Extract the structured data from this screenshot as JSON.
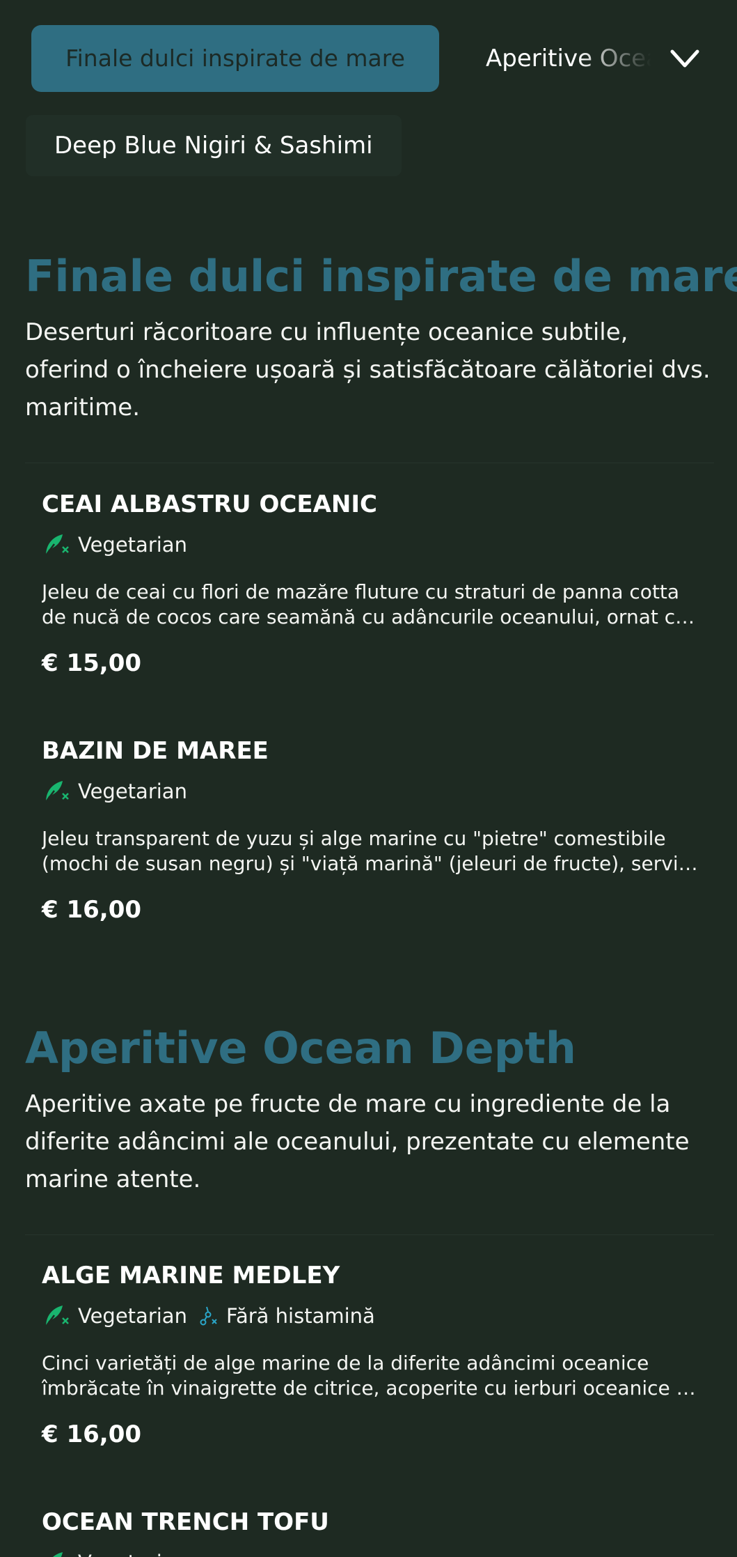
{
  "nav": {
    "active_tab": "Finale dulci inspirate de mare",
    "next_tab": "Aperitive Ocean Depth",
    "second_row_tab": "Deep Blue Nigiri & Sashimi",
    "expand_icon": "chevron-down-icon"
  },
  "colors": {
    "background": "#1e2a22",
    "accent": "#2f6e82",
    "vegetarian_icon": "#19b56f",
    "histamine_icon": "#2aa6c9"
  },
  "sections": [
    {
      "title": "Finale dulci inspirate de mare",
      "description": "Deserturi răcoritoare cu influențe oceanice subtile, oferind o încheiere ușoară și satisfăcătoare călătoriei dvs. maritime.",
      "items": [
        {
          "name": "CEAI ALBASTRU OCEANIC",
          "tags": [
            "Vegetarian"
          ],
          "description": "Jeleu de ceai cu flori de mazăre fluture cu straturi de panna cotta de nucă de cocos care seamănă cu adâncurile oceanului, ornat cu perle comestibile de sirop de agave.",
          "price": "€ 15,00"
        },
        {
          "name": "BAZIN DE MAREE",
          "tags": [
            "Vegetarian"
          ],
          "description": "Jeleu transparent de yuzu și alge marine cu \"pietre\" comestibile (mochi de susan negru) și \"viață marină\" (jeleuri de fructe), servit cu sos de ceai verde.",
          "price": "€ 16,00"
        }
      ]
    },
    {
      "title": "Aperitive Ocean Depth",
      "description": "Aperitive axate pe fructe de mare cu ingrediente de la diferite adâncimi ale oceanului, prezentate cu elemente marine atente.",
      "items": [
        {
          "name": "ALGE MARINE MEDLEY",
          "tags": [
            "Vegetarian",
            "Fără histamină"
          ],
          "description": "Cinci varietăți de alge marine de la diferite adâncimi oceanice îmbrăcate în vinaigrette de citrice, acoperite cu ierburi oceanice și semințe de susan prăjite.",
          "price": "€ 16,00"
        },
        {
          "name": "OCEAN TRENCH TOFU",
          "tags": [
            "Vegetarian"
          ]
        }
      ]
    }
  ]
}
